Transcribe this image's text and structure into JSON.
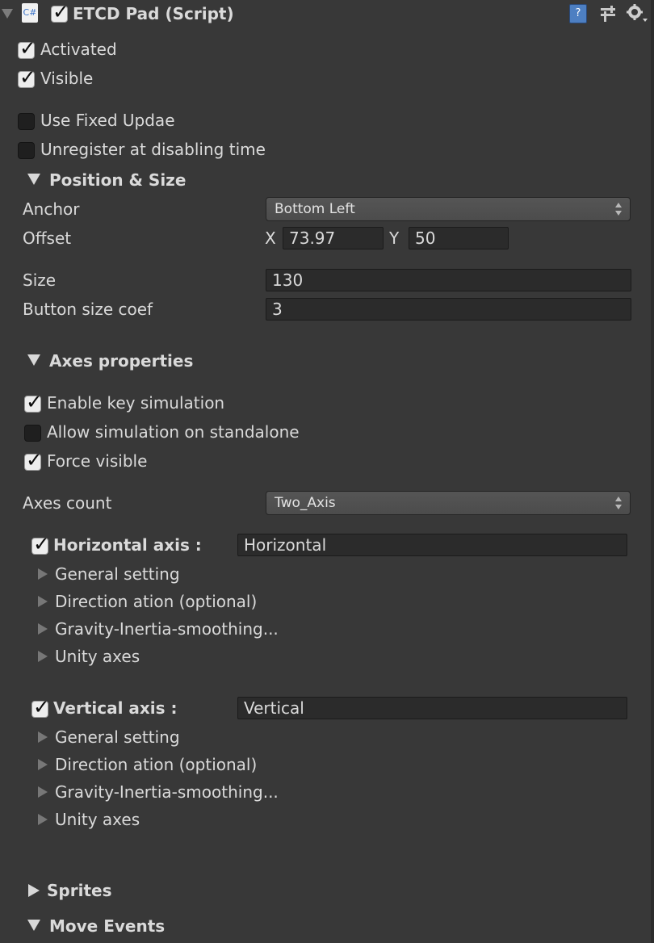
{
  "header": {
    "script_icon_label": "C#",
    "title": "ETCD Pad (Script)",
    "enabled": true
  },
  "options": {
    "activated": {
      "label": "Activated",
      "checked": true
    },
    "visible": {
      "label": "Visible",
      "checked": true
    },
    "use_fixed_update": {
      "label": "Use Fixed Updae",
      "checked": false
    },
    "unregister": {
      "label": "Unregister at disabling time",
      "checked": false
    }
  },
  "position_size": {
    "title": "Position & Size",
    "anchor_label": "Anchor",
    "anchor_value": "Bottom Left",
    "offset_label": "Offset",
    "x_label": "X",
    "x_value": "73.97",
    "y_label": "Y",
    "y_value": "50",
    "size_label": "Size",
    "size_value": "130",
    "button_size_coef_label": "Button size coef",
    "button_size_coef_value": "3"
  },
  "axes_properties": {
    "title": "Axes properties",
    "enable_key_simulation": {
      "label": "Enable key simulation",
      "checked": true
    },
    "allow_simulation_standalone": {
      "label": "Allow simulation on standalone",
      "checked": false
    },
    "force_visible": {
      "label": "Force visible",
      "checked": true
    },
    "axes_count_label": "Axes count",
    "axes_count_value": "Two_Axis"
  },
  "horizontal_axis": {
    "label": "Horizontal axis :",
    "checked": true,
    "name_value": "Horizontal",
    "sections": [
      "General setting",
      "Direction ation (optional)",
      "Gravity-Inertia-smoothing...",
      "Unity axes"
    ]
  },
  "vertical_axis": {
    "label": "Vertical axis :",
    "checked": true,
    "name_value": "Vertical",
    "sections": [
      "General setting",
      "Direction ation (optional)",
      "Gravity-Inertia-smoothing...",
      "Unity axes"
    ]
  },
  "footer_sections": {
    "sprites": "Sprites",
    "move_events": "Move Events"
  },
  "icons": {
    "help": "help-book-icon",
    "presets": "sliders-icon",
    "settings": "gear-icon"
  }
}
